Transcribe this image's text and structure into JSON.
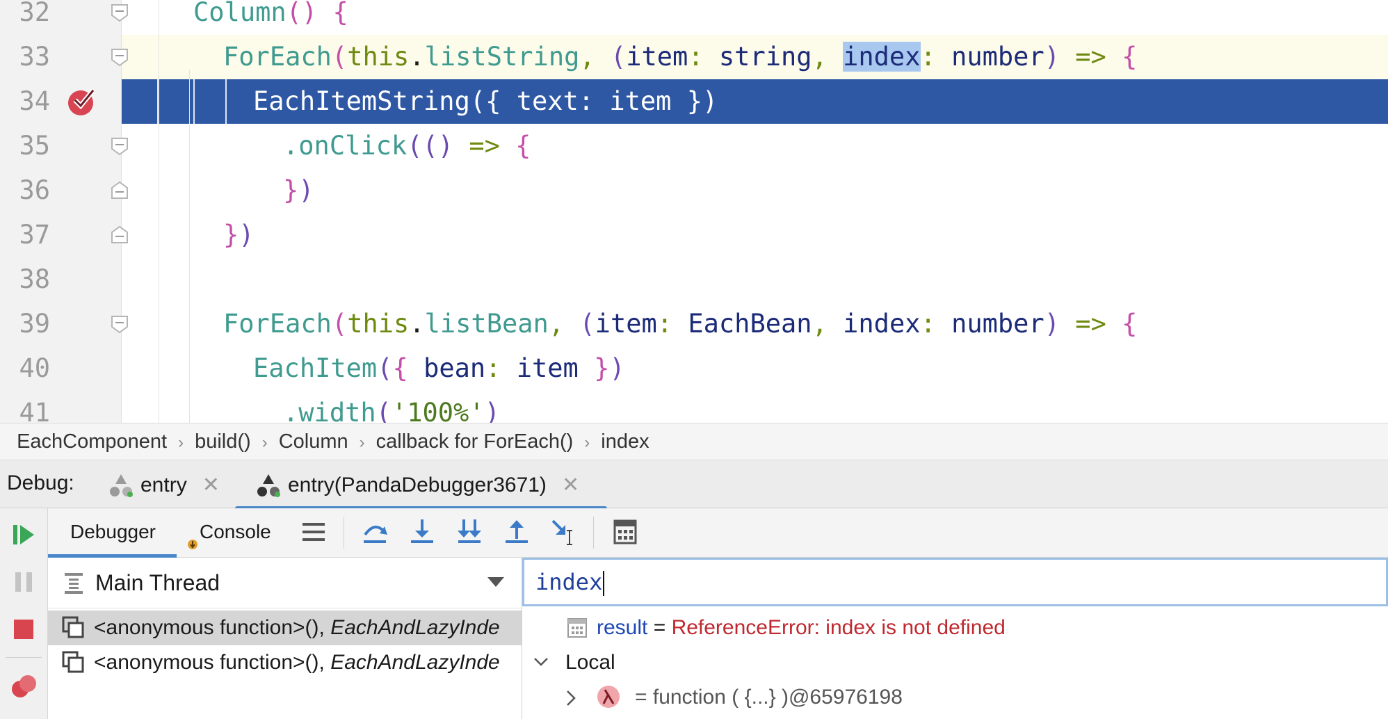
{
  "editor": {
    "lines": [
      {
        "num": "32",
        "parts": [
          [
            "k-teal",
            "Column"
          ],
          [
            "k-pink",
            "()"
          ],
          [
            "k-plain",
            " "
          ],
          [
            "k-pink",
            "{"
          ]
        ]
      },
      {
        "num": "33",
        "parts": [
          [
            "k-teal",
            "ForEach"
          ],
          [
            "k-pink",
            "("
          ],
          [
            "k-green",
            "this"
          ],
          [
            "k-plain",
            "."
          ],
          [
            "k-teal",
            "listString"
          ],
          [
            "k-green",
            ", "
          ],
          [
            "k-purple",
            "("
          ],
          [
            "k-navy",
            "item"
          ],
          [
            "k-green",
            ": "
          ],
          [
            "k-navy",
            "string"
          ],
          [
            "k-green",
            ", "
          ],
          [
            "hl",
            "index"
          ],
          [
            "k-green",
            ": "
          ],
          [
            "k-navy",
            "number"
          ],
          [
            "k-purple",
            ")"
          ],
          [
            "k-plain",
            " "
          ],
          [
            "k-green",
            "=>"
          ],
          [
            "k-plain",
            " "
          ],
          [
            "k-pink",
            "{"
          ]
        ]
      },
      {
        "num": "34",
        "parts": [
          [
            "k-plain",
            "EachItemString({ text: item })"
          ]
        ]
      },
      {
        "num": "35",
        "parts": [
          [
            "k-teal",
            ".onClick"
          ],
          [
            "k-purple",
            "(()"
          ],
          [
            "k-plain",
            " "
          ],
          [
            "k-green",
            "=>"
          ],
          [
            "k-plain",
            " "
          ],
          [
            "k-pink",
            "{"
          ]
        ]
      },
      {
        "num": "36",
        "parts": [
          [
            "k-pink",
            "}"
          ],
          [
            "k-purple",
            ")"
          ]
        ]
      },
      {
        "num": "37",
        "parts": [
          [
            "k-pink",
            "}"
          ],
          [
            "k-purple",
            ")"
          ]
        ]
      },
      {
        "num": "38",
        "parts": []
      },
      {
        "num": "39",
        "parts": [
          [
            "k-teal",
            "ForEach"
          ],
          [
            "k-pink",
            "("
          ],
          [
            "k-green",
            "this"
          ],
          [
            "k-plain",
            "."
          ],
          [
            "k-teal",
            "listBean"
          ],
          [
            "k-green",
            ", "
          ],
          [
            "k-purple",
            "("
          ],
          [
            "k-navy",
            "item"
          ],
          [
            "k-green",
            ": "
          ],
          [
            "k-navy",
            "EachBean"
          ],
          [
            "k-green",
            ", "
          ],
          [
            "k-navy",
            "index"
          ],
          [
            "k-green",
            ": "
          ],
          [
            "k-navy",
            "number"
          ],
          [
            "k-purple",
            ")"
          ],
          [
            "k-plain",
            " "
          ],
          [
            "k-green",
            "=>"
          ],
          [
            "k-plain",
            " "
          ],
          [
            "k-pink",
            "{"
          ]
        ]
      },
      {
        "num": "40",
        "parts": [
          [
            "k-teal",
            "EachItem"
          ],
          [
            "k-purple",
            "("
          ],
          [
            "k-pink",
            "{"
          ],
          [
            "k-plain",
            " "
          ],
          [
            "k-navy",
            "bean"
          ],
          [
            "k-green",
            ": "
          ],
          [
            "k-navy",
            "item"
          ],
          [
            "k-plain",
            " "
          ],
          [
            "k-pink",
            "}"
          ],
          [
            "k-purple",
            ")"
          ]
        ]
      },
      {
        "num": "41",
        "parts": [
          [
            "k-teal",
            ".width"
          ],
          [
            "k-purple",
            "("
          ],
          [
            "k-str",
            "'100%'"
          ],
          [
            "k-purple",
            ")"
          ]
        ]
      }
    ]
  },
  "breadcrumb": [
    "EachComponent",
    "build()",
    "Column",
    "callback for ForEach()",
    "index"
  ],
  "debug": {
    "label": "Debug:",
    "tabs": [
      {
        "label": "entry"
      },
      {
        "label": "entry(PandaDebugger3671)"
      }
    ]
  },
  "toolbar": {
    "debugger_tab": "Debugger",
    "console_tab": "Console"
  },
  "frames": {
    "thread": "Main Thread",
    "rows": [
      {
        "fn": "<anonymous function>(),",
        "file": "EachAndLazyInde"
      },
      {
        "fn": "<anonymous function>(),",
        "file": "EachAndLazyInde"
      }
    ]
  },
  "evaluate": {
    "expression": "index",
    "result_name": "result",
    "result_eq": " = ",
    "result_value": "ReferenceError: index is not defined",
    "local_label": "Local",
    "lambda_value": "= function ( {...} )@65976198"
  },
  "colors": {
    "accent": "#4a86c8",
    "exec_line": "#2f58a4",
    "error": "#c0282f",
    "breakpoint": "#d94452"
  }
}
